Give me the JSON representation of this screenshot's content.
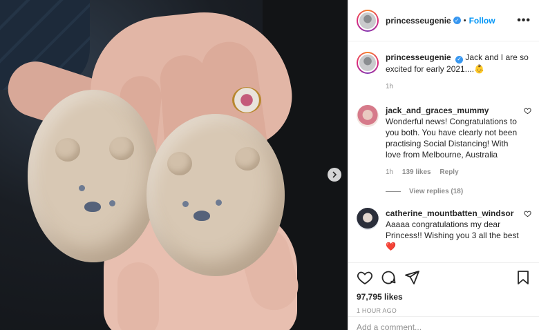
{
  "post": {
    "username": "princesseugenie",
    "follow_label": "Follow",
    "more_label": "•••",
    "separator": "•"
  },
  "caption": {
    "username": "princesseugenie",
    "text": "Jack and I are so excited for early 2021....👶",
    "age": "1h"
  },
  "comments": [
    {
      "username": "jack_and_graces_mummy",
      "text": "Wonderful news! Congratulations to you both. You have clearly not been practising Social Distancing! With love from Melbourne, Australia",
      "age": "1h",
      "likes": "139 likes",
      "reply_label": "Reply",
      "view_replies": "View replies (18)"
    },
    {
      "username": "catherine_mountbatten_windsor",
      "text": "Aaaaa congratulations my dear Princess!! Wishing you 3 all the best ❤️"
    }
  ],
  "footer": {
    "likes": "97,795 likes",
    "time": "1 HOUR AGO",
    "add_comment_placeholder": "Add a comment..."
  },
  "icons": {
    "verified": "verified-badge-icon",
    "like": "heart-icon",
    "comment": "comment-bubble-icon",
    "share": "paper-plane-icon",
    "save": "bookmark-icon",
    "next": "chevron-right-icon"
  },
  "colors": {
    "accent": "#0095f6",
    "verified": "#3897f0",
    "muted": "#8e8e8e",
    "heart_red": "#ed4956"
  }
}
